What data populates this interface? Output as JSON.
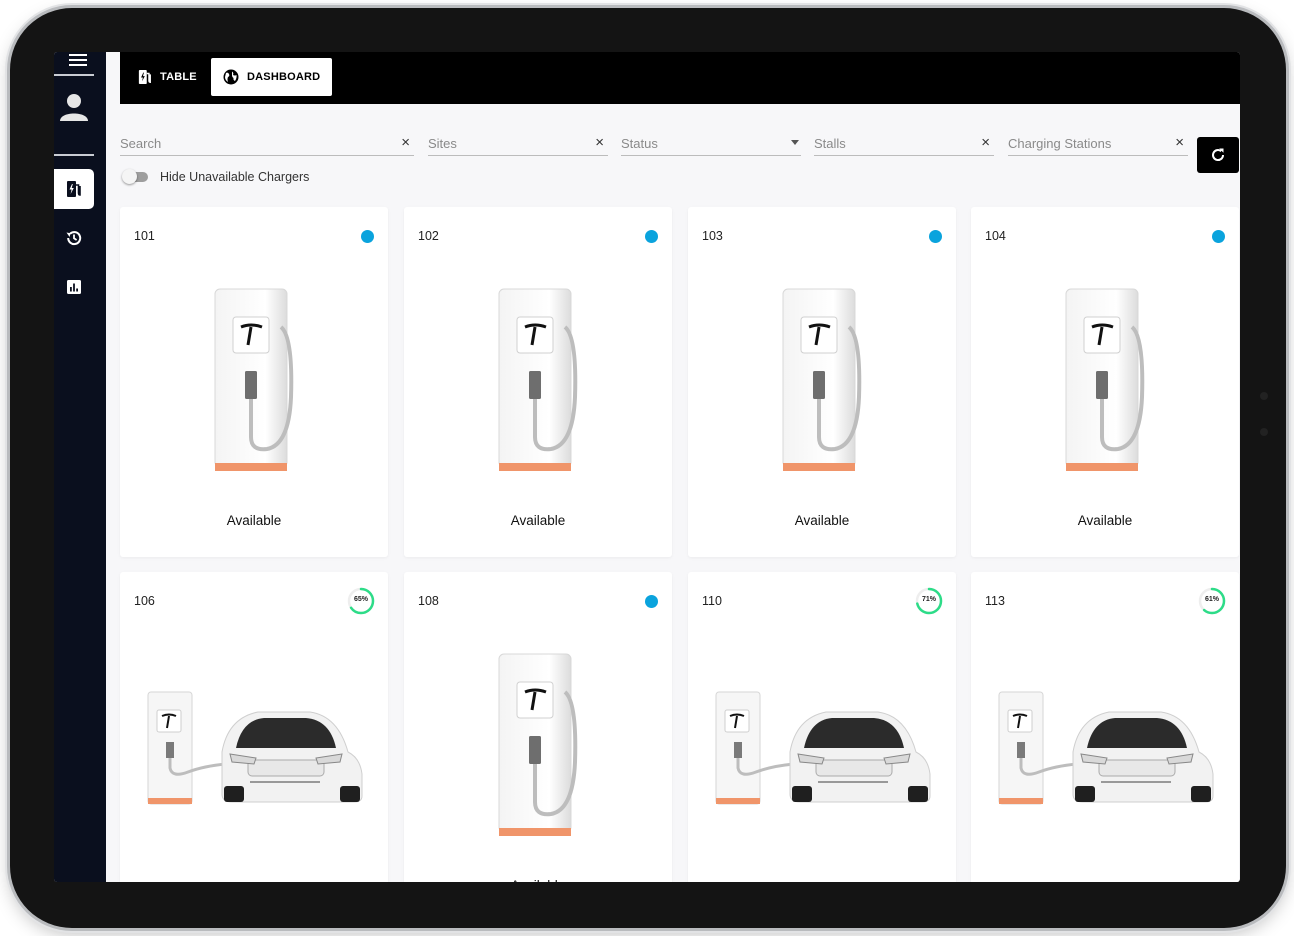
{
  "tabs": [
    {
      "label": "TABLE",
      "icon": "ev-station-icon"
    },
    {
      "label": "DASHBOARD",
      "icon": "globe-icon"
    }
  ],
  "filters": {
    "search_placeholder": "Search",
    "sites_placeholder": "Sites",
    "status_placeholder": "Status",
    "stalls_placeholder": "Stalls",
    "charging_stations_placeholder": "Charging Stations"
  },
  "toggle": {
    "label": "Hide Unavailable Chargers",
    "on": false
  },
  "sidebar": {
    "items": [
      {
        "icon": "ev-station-icon",
        "active": true
      },
      {
        "icon": "history-icon",
        "active": false
      },
      {
        "icon": "bar-chart-icon",
        "active": false
      }
    ]
  },
  "cards": [
    {
      "id": "101",
      "status": "Available",
      "indicator": "available"
    },
    {
      "id": "102",
      "status": "Available",
      "indicator": "available"
    },
    {
      "id": "103",
      "status": "Available",
      "indicator": "available"
    },
    {
      "id": "104",
      "status": "Available",
      "indicator": "available"
    },
    {
      "id": "106",
      "charge_label": "65%",
      "charge_pct": 0.65,
      "indicator": "charging"
    },
    {
      "id": "108",
      "status": "Available",
      "indicator": "available"
    },
    {
      "id": "110",
      "charge_label": "71%",
      "charge_pct": 0.71,
      "indicator": "charging"
    },
    {
      "id": "113",
      "charge_label": "61%",
      "charge_pct": 0.61,
      "indicator": "charging"
    }
  ],
  "colors": {
    "available_dot": "#0aa3dd",
    "charging_ring": "#2ddc88",
    "sidebar_bg": "#0a0f1e",
    "topbar_bg": "#000000",
    "charger_base": "#f0956a"
  }
}
